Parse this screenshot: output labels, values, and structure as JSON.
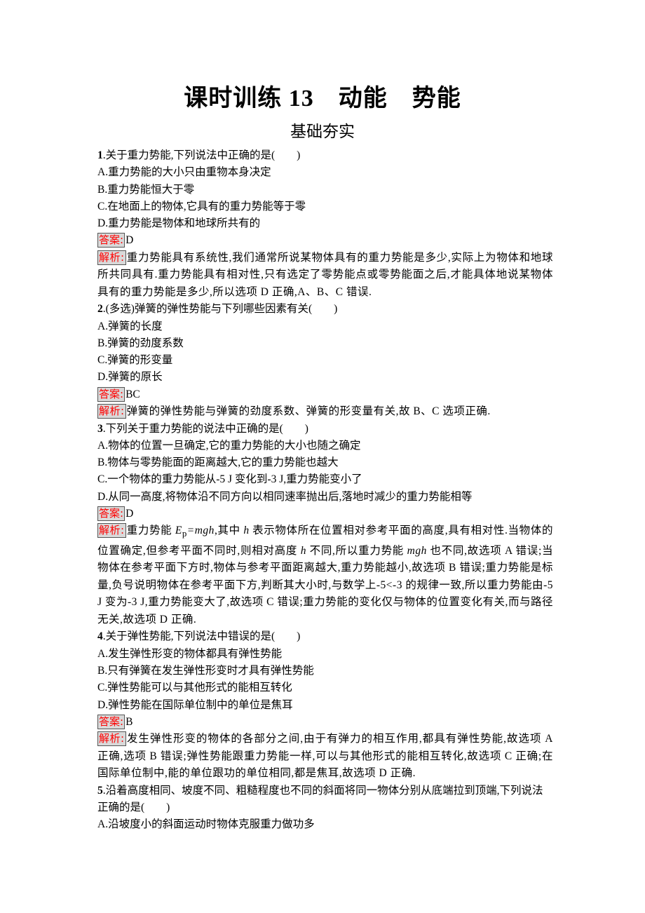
{
  "header": {
    "title": "课时训练 13　动能　势能",
    "section": "基础夯实"
  },
  "labels": {
    "answer": "答案:",
    "analysis": "解析:"
  },
  "questions": [
    {
      "number": "1",
      "stem": ".关于重力势能,下列说法中正确的是(　　)",
      "options": [
        "A.重力势能的大小只由重物本身决定",
        "B.重力势能恒大于零",
        "C.在地面上的物体,它具有的重力势能等于零",
        "D.重力势能是物体和地球所共有的"
      ],
      "answer": "D",
      "analysis": "重力势能具有系统性,我们通常所说某物体具有的重力势能是多少,实际上为物体和地球所共同具有.重力势能具有相对性,只有选定了零势能点或零势能面之后,才能具体地说某物体具有的重力势能是多少,所以选项 D 正确,A、B、C 错误."
    },
    {
      "number": "2",
      "stem": ".(多选)弹簧的弹性势能与下列哪些因素有关(　　)",
      "options": [
        "A.弹簧的长度",
        "B.弹簧的劲度系数",
        "C.弹簧的形变量",
        "D.弹簧的原长"
      ],
      "answer": "BC",
      "analysis": "弹簧的弹性势能与弹簧的劲度系数、弹簧的形变量有关,故 B、C 选项正确."
    },
    {
      "number": "3",
      "stem": ".下列关于重力势能的说法中正确的是(　　)",
      "options": [
        "A.物体的位置一旦确定,它的重力势能的大小也随之确定",
        "B.物体与零势能面的距离越大,它的重力势能也越大",
        "C.一个物体的重力势能从-5 J 变化到-3 J,重力势能变小了",
        "D.从同一高度,将物体沿不同方向以相同速率抛出后,落地时减少的重力势能相等"
      ],
      "answer": "D",
      "analysis_parts": {
        "p1": "重力势能 ",
        "formula_E": "E",
        "formula_sub": "p",
        "formula_rest": "=mgh",
        "p2": ",其中 ",
        "h1": "h",
        "p3": " 表示物体所在位置相对参考平面的高度,具有相对性.当物体的位置确定,但参考平面不同时,则相对高度 ",
        "h2": "h",
        "p4": " 不同,所以重力势能 ",
        "mgh": "mgh",
        "p5": " 也不同,故选项 A 错误;当物体在参考平面下方时,物体与参考平面距离越大,重力势能越小,故选项 B 错误;重力势能是标量,负号说明物体在参考平面下方,判断其大小时,与数学上-5<-3 的规律一致,所以重力势能由-5 J 变为-3 J,重力势能变大了,故选项 C 错误;重力势能的变化仅与物体的位置变化有关,而与路径无关,故选项 D 正确."
      }
    },
    {
      "number": "4",
      "stem": ".关于弹性势能,下列说法中错误的是(　　)",
      "options": [
        "A.发生弹性形变的物体都具有弹性势能",
        "B.只有弹簧在发生弹性形变时才具有弹性势能",
        "C.弹性势能可以与其他形式的能相互转化",
        "D.弹性势能在国际单位制中的单位是焦耳"
      ],
      "answer": "B",
      "analysis": "发生弹性形变的物体的各部分之间,由于有弹力的相互作用,都具有弹性势能,故选项 A 正确,选项 B 错误;弹性势能跟重力势能一样,可以与其他形式的能相互转化,故选项 C 正确;在国际单位制中,能的单位跟功的单位相同,都是焦耳,故选项 D 正确."
    },
    {
      "number": "5",
      "stem": ".沿着高度相同、坡度不同、粗糙程度也不同的斜面将同一物体分别从底端拉到顶端,下列说法正确的是(　　)",
      "options": [
        "A.沿坡度小的斜面运动时物体克服重力做功多"
      ]
    }
  ]
}
